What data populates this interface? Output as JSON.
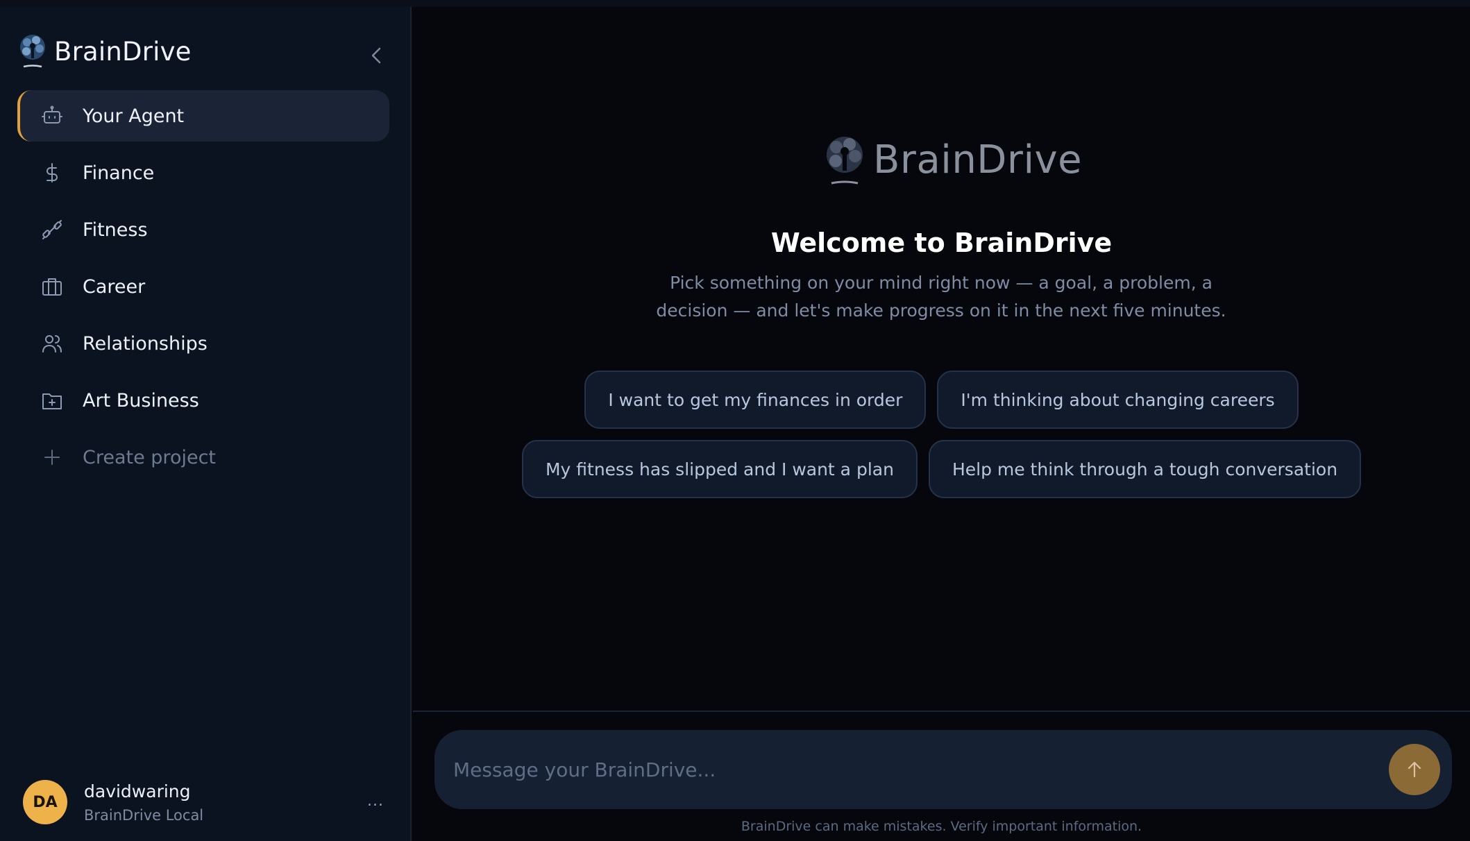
{
  "app": {
    "brand": "BrainDrive"
  },
  "sidebar": {
    "items": [
      {
        "label": "Your Agent",
        "icon": "robot-icon",
        "active": true
      },
      {
        "label": "Finance",
        "icon": "dollar-icon"
      },
      {
        "label": "Fitness",
        "icon": "dumbbell-icon"
      },
      {
        "label": "Career",
        "icon": "briefcase-icon"
      },
      {
        "label": "Relationships",
        "icon": "users-icon"
      },
      {
        "label": "Art Business",
        "icon": "folder-plus-icon"
      }
    ],
    "create_label": "Create project",
    "user": {
      "initials": "DA",
      "name": "davidwaring",
      "subtitle": "BrainDrive Local",
      "more": "..."
    }
  },
  "main": {
    "brand": "BrainDrive",
    "welcome": "Welcome to BrainDrive",
    "subtitle": "Pick something on your mind right now — a goal, a problem, a decision — and let's make progress on it in the next five minutes.",
    "suggestions": [
      "I want to get my finances in order",
      "I'm thinking about changing careers",
      "My fitness has slipped and I want a plan",
      "Help me think through a tough conversation"
    ],
    "composer": {
      "placeholder": "Message your BrainDrive..."
    },
    "disclaimer": "BrainDrive can make mistakes. Verify important information."
  },
  "colors": {
    "accent": "#e0a13a",
    "avatar": "#eeb24a",
    "send": "#8c6a36"
  }
}
